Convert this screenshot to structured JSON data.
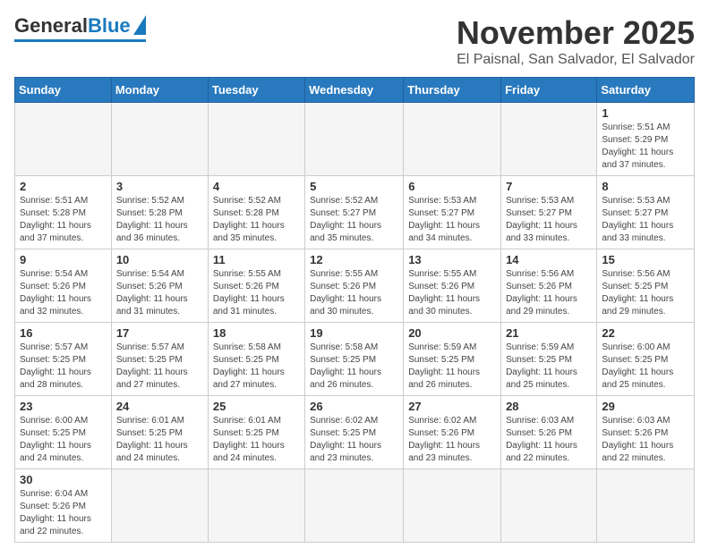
{
  "logo": {
    "general": "General",
    "blue": "Blue"
  },
  "header": {
    "month": "November 2025",
    "location": "El Paisnal, San Salvador, El Salvador"
  },
  "weekdays": [
    "Sunday",
    "Monday",
    "Tuesday",
    "Wednesday",
    "Thursday",
    "Friday",
    "Saturday"
  ],
  "weeks": [
    [
      {
        "day": "",
        "info": ""
      },
      {
        "day": "",
        "info": ""
      },
      {
        "day": "",
        "info": ""
      },
      {
        "day": "",
        "info": ""
      },
      {
        "day": "",
        "info": ""
      },
      {
        "day": "",
        "info": ""
      },
      {
        "day": "1",
        "info": "Sunrise: 5:51 AM\nSunset: 5:29 PM\nDaylight: 11 hours and 37 minutes."
      }
    ],
    [
      {
        "day": "2",
        "info": "Sunrise: 5:51 AM\nSunset: 5:28 PM\nDaylight: 11 hours and 37 minutes."
      },
      {
        "day": "3",
        "info": "Sunrise: 5:52 AM\nSunset: 5:28 PM\nDaylight: 11 hours and 36 minutes."
      },
      {
        "day": "4",
        "info": "Sunrise: 5:52 AM\nSunset: 5:28 PM\nDaylight: 11 hours and 35 minutes."
      },
      {
        "day": "5",
        "info": "Sunrise: 5:52 AM\nSunset: 5:27 PM\nDaylight: 11 hours and 35 minutes."
      },
      {
        "day": "6",
        "info": "Sunrise: 5:53 AM\nSunset: 5:27 PM\nDaylight: 11 hours and 34 minutes."
      },
      {
        "day": "7",
        "info": "Sunrise: 5:53 AM\nSunset: 5:27 PM\nDaylight: 11 hours and 33 minutes."
      },
      {
        "day": "8",
        "info": "Sunrise: 5:53 AM\nSunset: 5:27 PM\nDaylight: 11 hours and 33 minutes."
      }
    ],
    [
      {
        "day": "9",
        "info": "Sunrise: 5:54 AM\nSunset: 5:26 PM\nDaylight: 11 hours and 32 minutes."
      },
      {
        "day": "10",
        "info": "Sunrise: 5:54 AM\nSunset: 5:26 PM\nDaylight: 11 hours and 31 minutes."
      },
      {
        "day": "11",
        "info": "Sunrise: 5:55 AM\nSunset: 5:26 PM\nDaylight: 11 hours and 31 minutes."
      },
      {
        "day": "12",
        "info": "Sunrise: 5:55 AM\nSunset: 5:26 PM\nDaylight: 11 hours and 30 minutes."
      },
      {
        "day": "13",
        "info": "Sunrise: 5:55 AM\nSunset: 5:26 PM\nDaylight: 11 hours and 30 minutes."
      },
      {
        "day": "14",
        "info": "Sunrise: 5:56 AM\nSunset: 5:26 PM\nDaylight: 11 hours and 29 minutes."
      },
      {
        "day": "15",
        "info": "Sunrise: 5:56 AM\nSunset: 5:25 PM\nDaylight: 11 hours and 29 minutes."
      }
    ],
    [
      {
        "day": "16",
        "info": "Sunrise: 5:57 AM\nSunset: 5:25 PM\nDaylight: 11 hours and 28 minutes."
      },
      {
        "day": "17",
        "info": "Sunrise: 5:57 AM\nSunset: 5:25 PM\nDaylight: 11 hours and 27 minutes."
      },
      {
        "day": "18",
        "info": "Sunrise: 5:58 AM\nSunset: 5:25 PM\nDaylight: 11 hours and 27 minutes."
      },
      {
        "day": "19",
        "info": "Sunrise: 5:58 AM\nSunset: 5:25 PM\nDaylight: 11 hours and 26 minutes."
      },
      {
        "day": "20",
        "info": "Sunrise: 5:59 AM\nSunset: 5:25 PM\nDaylight: 11 hours and 26 minutes."
      },
      {
        "day": "21",
        "info": "Sunrise: 5:59 AM\nSunset: 5:25 PM\nDaylight: 11 hours and 25 minutes."
      },
      {
        "day": "22",
        "info": "Sunrise: 6:00 AM\nSunset: 5:25 PM\nDaylight: 11 hours and 25 minutes."
      }
    ],
    [
      {
        "day": "23",
        "info": "Sunrise: 6:00 AM\nSunset: 5:25 PM\nDaylight: 11 hours and 24 minutes."
      },
      {
        "day": "24",
        "info": "Sunrise: 6:01 AM\nSunset: 5:25 PM\nDaylight: 11 hours and 24 minutes."
      },
      {
        "day": "25",
        "info": "Sunrise: 6:01 AM\nSunset: 5:25 PM\nDaylight: 11 hours and 24 minutes."
      },
      {
        "day": "26",
        "info": "Sunrise: 6:02 AM\nSunset: 5:25 PM\nDaylight: 11 hours and 23 minutes."
      },
      {
        "day": "27",
        "info": "Sunrise: 6:02 AM\nSunset: 5:26 PM\nDaylight: 11 hours and 23 minutes."
      },
      {
        "day": "28",
        "info": "Sunrise: 6:03 AM\nSunset: 5:26 PM\nDaylight: 11 hours and 22 minutes."
      },
      {
        "day": "29",
        "info": "Sunrise: 6:03 AM\nSunset: 5:26 PM\nDaylight: 11 hours and 22 minutes."
      }
    ],
    [
      {
        "day": "30",
        "info": "Sunrise: 6:04 AM\nSunset: 5:26 PM\nDaylight: 11 hours and 22 minutes."
      },
      {
        "day": "",
        "info": ""
      },
      {
        "day": "",
        "info": ""
      },
      {
        "day": "",
        "info": ""
      },
      {
        "day": "",
        "info": ""
      },
      {
        "day": "",
        "info": ""
      },
      {
        "day": "",
        "info": ""
      }
    ]
  ]
}
